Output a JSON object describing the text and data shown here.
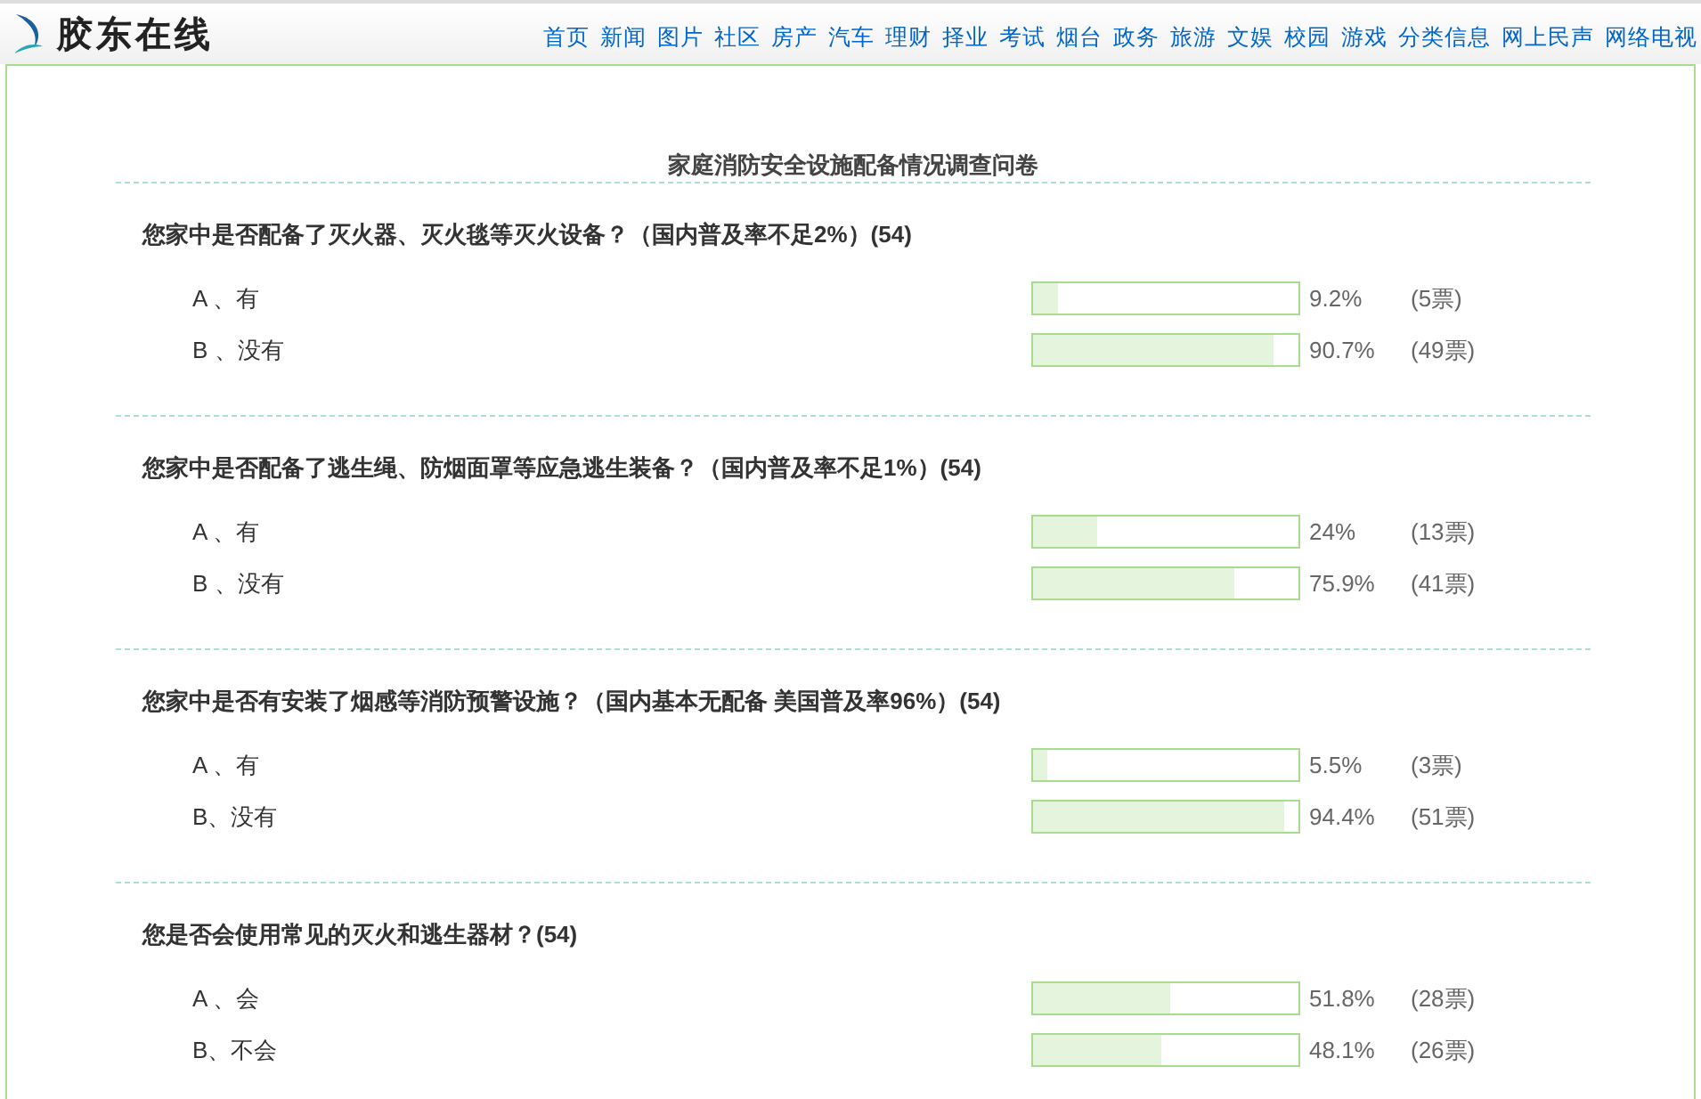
{
  "header": {
    "logo": "胶东在线",
    "nav": [
      "首页",
      "新闻",
      "图片",
      "社区",
      "房产",
      "汽车",
      "理财",
      "择业",
      "考试",
      "烟台",
      "政务",
      "旅游",
      "文娱",
      "校园",
      "游戏",
      "分类信息",
      "网上民声",
      "网络电视"
    ]
  },
  "survey": {
    "title": "家庭消防安全设施配备情况调查问卷",
    "questions": [
      {
        "text": "您家中是否配备了灭火器、灭火毯等灭火设备？（国内普及率不足2%）(54)",
        "options": [
          {
            "label": "A 、有",
            "level": 0.092,
            "percent": "9.2%",
            "votes": "(5票)"
          },
          {
            "label": "B 、没有",
            "level": 0.907,
            "percent": "90.7%",
            "votes": "(49票)"
          }
        ]
      },
      {
        "text": "您家中是否配备了逃生绳、防烟面罩等应急逃生装备？（国内普及率不足1%）(54)",
        "options": [
          {
            "label": "A 、有",
            "level": 0.24,
            "percent": "24%",
            "votes": "(13票)"
          },
          {
            "label": "B 、没有",
            "level": 0.759,
            "percent": "75.9%",
            "votes": "(41票)"
          }
        ]
      },
      {
        "text": "您家中是否有安装了烟感等消防预警设施？（国内基本无配备 美国普及率96%）(54)",
        "options": [
          {
            "label": "A 、有",
            "level": 0.055,
            "percent": "5.5%",
            "votes": "(3票)"
          },
          {
            "label": "B、没有",
            "level": 0.944,
            "percent": "94.4%",
            "votes": "(51票)"
          }
        ]
      },
      {
        "text": "您是否会使用常见的灭火和逃生器材？(54)",
        "options": [
          {
            "label": "A 、会",
            "level": 0.518,
            "percent": "51.8%",
            "votes": "(28票)"
          },
          {
            "label": "B、不会",
            "level": 0.481,
            "percent": "48.1%",
            "votes": "(26票)"
          }
        ]
      }
    ]
  }
}
